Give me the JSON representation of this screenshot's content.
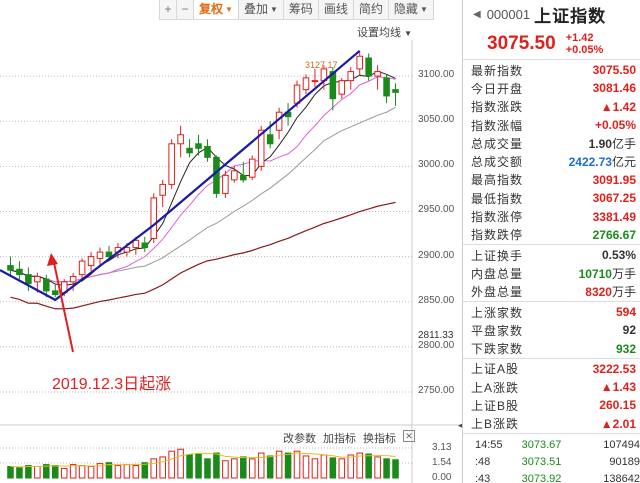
{
  "toolbar": {
    "zoom_in": "+",
    "zoom_out": "−",
    "adjust_label": "复权",
    "overlay_label": "叠加",
    "chips_label": "筹码",
    "drawing_label": "画线",
    "simple_label": "简约",
    "hide_label": "隐藏"
  },
  "chart": {
    "ma_setting_label": "设置均线",
    "peak_label": "3127.17",
    "current_price_label": "2811.33",
    "y_ticks": [
      "3100.00",
      "3050.00",
      "3000.00",
      "2950.00",
      "2900.00",
      "2850.00",
      "2800.00",
      "2750.00"
    ],
    "annotation_text": "2019.12.3日起涨",
    "colors": {
      "up": "#e0201b",
      "down": "#1a8a1a",
      "trend": "#1a1aa8",
      "ma5": "#222222",
      "ma10": "#e060e0",
      "ma20": "#9a9a9a",
      "ma60": "#8b1a1a"
    }
  },
  "chart_data": {
    "type": "candlestick",
    "ylim": [
      2730,
      3140
    ],
    "candles": [
      {
        "o": 2890,
        "h": 2900,
        "l": 2880,
        "c": 2885
      },
      {
        "o": 2886,
        "h": 2895,
        "l": 2875,
        "c": 2880
      },
      {
        "o": 2880,
        "h": 2888,
        "l": 2862,
        "c": 2870
      },
      {
        "o": 2872,
        "h": 2882,
        "l": 2860,
        "c": 2878
      },
      {
        "o": 2875,
        "h": 2880,
        "l": 2855,
        "c": 2862
      },
      {
        "o": 2862,
        "h": 2870,
        "l": 2855,
        "c": 2858
      },
      {
        "o": 2860,
        "h": 2875,
        "l": 2856,
        "c": 2872
      },
      {
        "o": 2872,
        "h": 2882,
        "l": 2862,
        "c": 2878
      },
      {
        "o": 2880,
        "h": 2898,
        "l": 2875,
        "c": 2895
      },
      {
        "o": 2890,
        "h": 2905,
        "l": 2884,
        "c": 2900
      },
      {
        "o": 2898,
        "h": 2910,
        "l": 2890,
        "c": 2905
      },
      {
        "o": 2905,
        "h": 2912,
        "l": 2896,
        "c": 2900
      },
      {
        "o": 2905,
        "h": 2915,
        "l": 2898,
        "c": 2910
      },
      {
        "o": 2905,
        "h": 2915,
        "l": 2900,
        "c": 2910
      },
      {
        "o": 2910,
        "h": 2922,
        "l": 2902,
        "c": 2918
      },
      {
        "o": 2915,
        "h": 2922,
        "l": 2905,
        "c": 2910
      },
      {
        "o": 2920,
        "h": 2970,
        "l": 2915,
        "c": 2965
      },
      {
        "o": 2968,
        "h": 2985,
        "l": 2955,
        "c": 2980
      },
      {
        "o": 2980,
        "h": 3030,
        "l": 2975,
        "c": 3025
      },
      {
        "o": 3025,
        "h": 3045,
        "l": 3010,
        "c": 3035
      },
      {
        "o": 3020,
        "h": 3030,
        "l": 3010,
        "c": 3015
      },
      {
        "o": 3025,
        "h": 3035,
        "l": 3012,
        "c": 3020
      },
      {
        "o": 3022,
        "h": 3030,
        "l": 3005,
        "c": 3010
      },
      {
        "o": 3010,
        "h": 3012,
        "l": 2965,
        "c": 2970
      },
      {
        "o": 2970,
        "h": 2995,
        "l": 2965,
        "c": 2990
      },
      {
        "o": 2985,
        "h": 3000,
        "l": 2982,
        "c": 2995
      },
      {
        "o": 2990,
        "h": 3005,
        "l": 2982,
        "c": 2985
      },
      {
        "o": 2988,
        "h": 3012,
        "l": 2985,
        "c": 3008
      },
      {
        "o": 3000,
        "h": 3045,
        "l": 2995,
        "c": 3040
      },
      {
        "o": 3035,
        "h": 3050,
        "l": 3020,
        "c": 3025
      },
      {
        "o": 3040,
        "h": 3065,
        "l": 3030,
        "c": 3060
      },
      {
        "o": 3060,
        "h": 3070,
        "l": 3045,
        "c": 3055
      },
      {
        "o": 3070,
        "h": 3095,
        "l": 3065,
        "c": 3090
      },
      {
        "o": 3085,
        "h": 3102,
        "l": 3080,
        "c": 3098
      },
      {
        "o": 3095,
        "h": 3108,
        "l": 3088,
        "c": 3095
      },
      {
        "o": 3095,
        "h": 3112,
        "l": 3085,
        "c": 3108
      },
      {
        "o": 3105,
        "h": 3110,
        "l": 3062,
        "c": 3075
      },
      {
        "o": 3080,
        "h": 3098,
        "l": 3075,
        "c": 3095
      },
      {
        "o": 3095,
        "h": 3110,
        "l": 3085,
        "c": 3105
      },
      {
        "o": 3108,
        "h": 3127,
        "l": 3100,
        "c": 3122
      },
      {
        "o": 3120,
        "h": 3125,
        "l": 3095,
        "c": 3100
      },
      {
        "o": 3100,
        "h": 3112,
        "l": 3085,
        "c": 3105
      },
      {
        "o": 3098,
        "h": 3102,
        "l": 3070,
        "c": 3078
      },
      {
        "o": 3085,
        "h": 3092,
        "l": 3067,
        "c": 3082
      }
    ],
    "volumes": [
      1.2,
      1.1,
      1.3,
      1.2,
      1.4,
      1.3,
      1.0,
      1.4,
      1.3,
      1.2,
      1.5,
      1.6,
      1.3,
      1.4,
      1.3,
      1.6,
      2.0,
      2.2,
      2.8,
      3.0,
      2.4,
      2.5,
      2.0,
      2.6,
      1.8,
      2.0,
      2.2,
      2.0,
      2.6,
      2.3,
      2.8,
      2.6,
      2.8,
      2.3,
      2.0,
      2.4,
      2.1,
      2.0,
      2.4,
      2.6,
      2.5,
      2.2,
      2.0,
      1.9
    ],
    "volume_ticks": [
      "3.13",
      "1.54",
      "0.00"
    ]
  },
  "panel": {
    "code": "000001",
    "name": "上证指数",
    "price": "3075.50",
    "change": "+1.42",
    "change_pct": "+0.05%",
    "group1": [
      {
        "label": "最新指数",
        "value": "3075.50",
        "color": "red"
      },
      {
        "label": "今日开盘",
        "value": "3081.46",
        "color": "red"
      },
      {
        "label": "指数涨跌",
        "value": "▲1.42",
        "color": "red"
      },
      {
        "label": "指数涨幅",
        "value": "+0.05%",
        "color": "red"
      },
      {
        "label": "总成交量",
        "value": "1.90",
        "unit": "亿手",
        "color": "dark"
      },
      {
        "label": "总成交额",
        "value": "2422.73",
        "unit": "亿元",
        "color": "blue"
      },
      {
        "label": "最高指数",
        "value": "3091.95",
        "color": "red"
      },
      {
        "label": "最低指数",
        "value": "3067.25",
        "color": "red"
      },
      {
        "label": "指数涨停",
        "value": "3381.49",
        "color": "red"
      },
      {
        "label": "指数跌停",
        "value": "2766.67",
        "color": "green"
      }
    ],
    "group2": [
      {
        "label": "上证换手",
        "value": "0.53%",
        "color": "dark"
      },
      {
        "label": "内盘总量",
        "value": "10710",
        "unit": "万手",
        "color": "green"
      },
      {
        "label": "外盘总量",
        "value": "8320",
        "unit": "万手",
        "color": "red"
      }
    ],
    "group3": [
      {
        "label": "上涨家数",
        "value": "594",
        "color": "red"
      },
      {
        "label": "平盘家数",
        "value": "92",
        "color": "dark"
      },
      {
        "label": "下跌家数",
        "value": "932",
        "color": "green"
      }
    ],
    "group4": [
      {
        "label": "上证A股",
        "value": "3222.53",
        "color": "red"
      },
      {
        "label": "上A涨跌",
        "value": "▲1.43",
        "color": "red"
      },
      {
        "label": "上证B股",
        "value": "260.15",
        "color": "red"
      },
      {
        "label": "上B涨跌",
        "value": "▲2.01",
        "color": "red"
      }
    ],
    "ticks": [
      {
        "time": "14:55",
        "price": "3073.67",
        "vol": "107494"
      },
      {
        "time": ":48",
        "price": "3073.51",
        "vol": "90189"
      },
      {
        "time": ":43",
        "price": "3073.92",
        "vol": "138642"
      }
    ]
  },
  "indicator_bar": {
    "params_label": "改参数",
    "add_label": "加指标",
    "switch_label": "换指标",
    "close_label": "✕"
  }
}
